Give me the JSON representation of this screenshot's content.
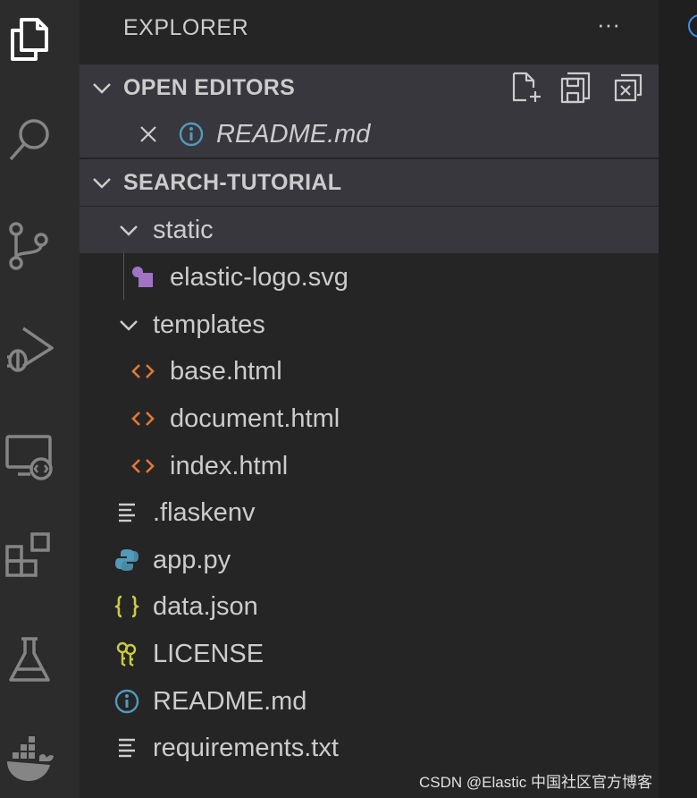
{
  "activity_bar": {
    "items": [
      {
        "name": "explorer",
        "icon": "files-icon"
      },
      {
        "name": "search",
        "icon": "search-icon"
      },
      {
        "name": "source-control",
        "icon": "source-control-icon"
      },
      {
        "name": "run-debug",
        "icon": "run-debug-icon"
      },
      {
        "name": "remote-explorer",
        "icon": "remote-explorer-icon"
      },
      {
        "name": "extensions",
        "icon": "extensions-icon"
      },
      {
        "name": "testing",
        "icon": "flask-icon"
      },
      {
        "name": "docker",
        "icon": "docker-icon"
      }
    ]
  },
  "explorer": {
    "title": "EXPLORER",
    "more_actions": "···"
  },
  "open_editors": {
    "label": "OPEN EDITORS",
    "files": [
      {
        "name": "README.md",
        "icon": "info-icon"
      }
    ]
  },
  "workspace": {
    "label": "SEARCH-TUTORIAL",
    "folders": {
      "static": {
        "label": "static",
        "files": [
          {
            "name": "elastic-logo.svg",
            "icon": "svg-file-icon"
          }
        ]
      },
      "templates": {
        "label": "templates",
        "files": [
          {
            "name": "base.html",
            "icon": "html-file-icon"
          },
          {
            "name": "document.html",
            "icon": "html-file-icon"
          },
          {
            "name": "index.html",
            "icon": "html-file-icon"
          }
        ]
      }
    },
    "files": [
      {
        "name": ".flaskenv",
        "icon": "text-file-icon"
      },
      {
        "name": "app.py",
        "icon": "python-icon"
      },
      {
        "name": "data.json",
        "icon": "json-icon"
      },
      {
        "name": "LICENSE",
        "icon": "license-key-icon"
      },
      {
        "name": "README.md",
        "icon": "info-icon"
      },
      {
        "name": "requirements.txt",
        "icon": "text-file-icon"
      }
    ]
  },
  "colors": {
    "activity_bar_bg": "#2c2c2c",
    "sidebar_bg": "#252526",
    "selection_bg": "#37373d",
    "html_icon": "#e37933",
    "json_icon": "#cbcb41",
    "info_icon": "#519aba",
    "svg_icon": "#a074c4"
  },
  "watermark": "CSDN @Elastic 中国社区官方博客"
}
